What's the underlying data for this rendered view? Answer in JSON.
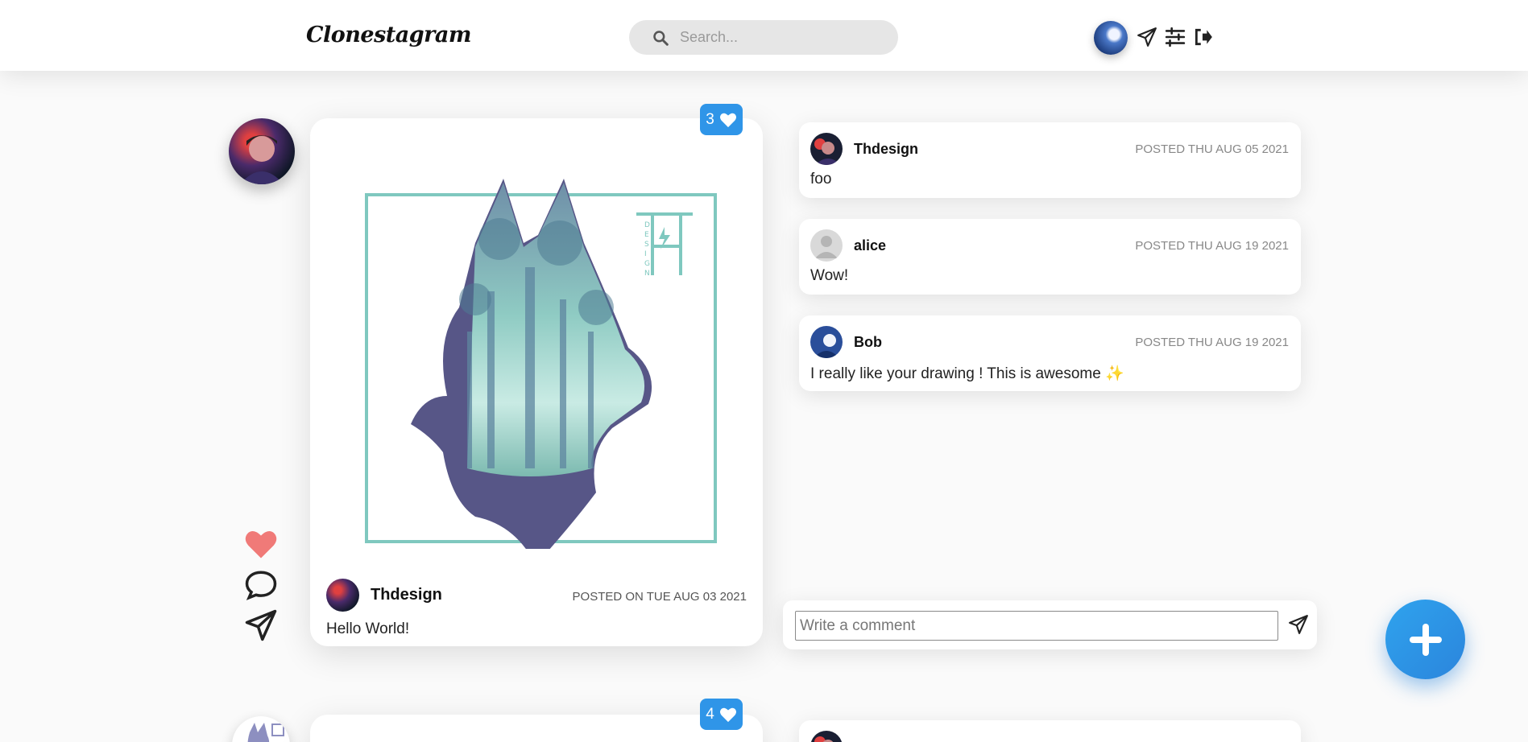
{
  "header": {
    "logo": "Clonestagram",
    "search_placeholder": "Search..."
  },
  "post": {
    "likes": "3",
    "author": "Thdesign",
    "date": "POSTED ON TUE AUG 03 2021",
    "caption": "Hello World!",
    "art_letters": [
      "D",
      "E",
      "S",
      "I",
      "G",
      "N"
    ]
  },
  "comments": [
    {
      "author": "Thdesign",
      "date": "POSTED THU AUG 05 2021",
      "text": "foo"
    },
    {
      "author": "alice",
      "date": "POSTED THU AUG 19 2021",
      "text": "Wow!"
    },
    {
      "author": "Bob",
      "date": "POSTED THU AUG 19 2021",
      "text": "I really like your drawing ! This is awesome ✨"
    }
  ],
  "comment_form": {
    "placeholder": "Write a comment"
  },
  "post2": {
    "likes": "4"
  },
  "colors": {
    "accent": "#2f95e8",
    "heart": "#f07a78",
    "art_teal": "#7fc8bf",
    "art_purple": "#575687"
  }
}
